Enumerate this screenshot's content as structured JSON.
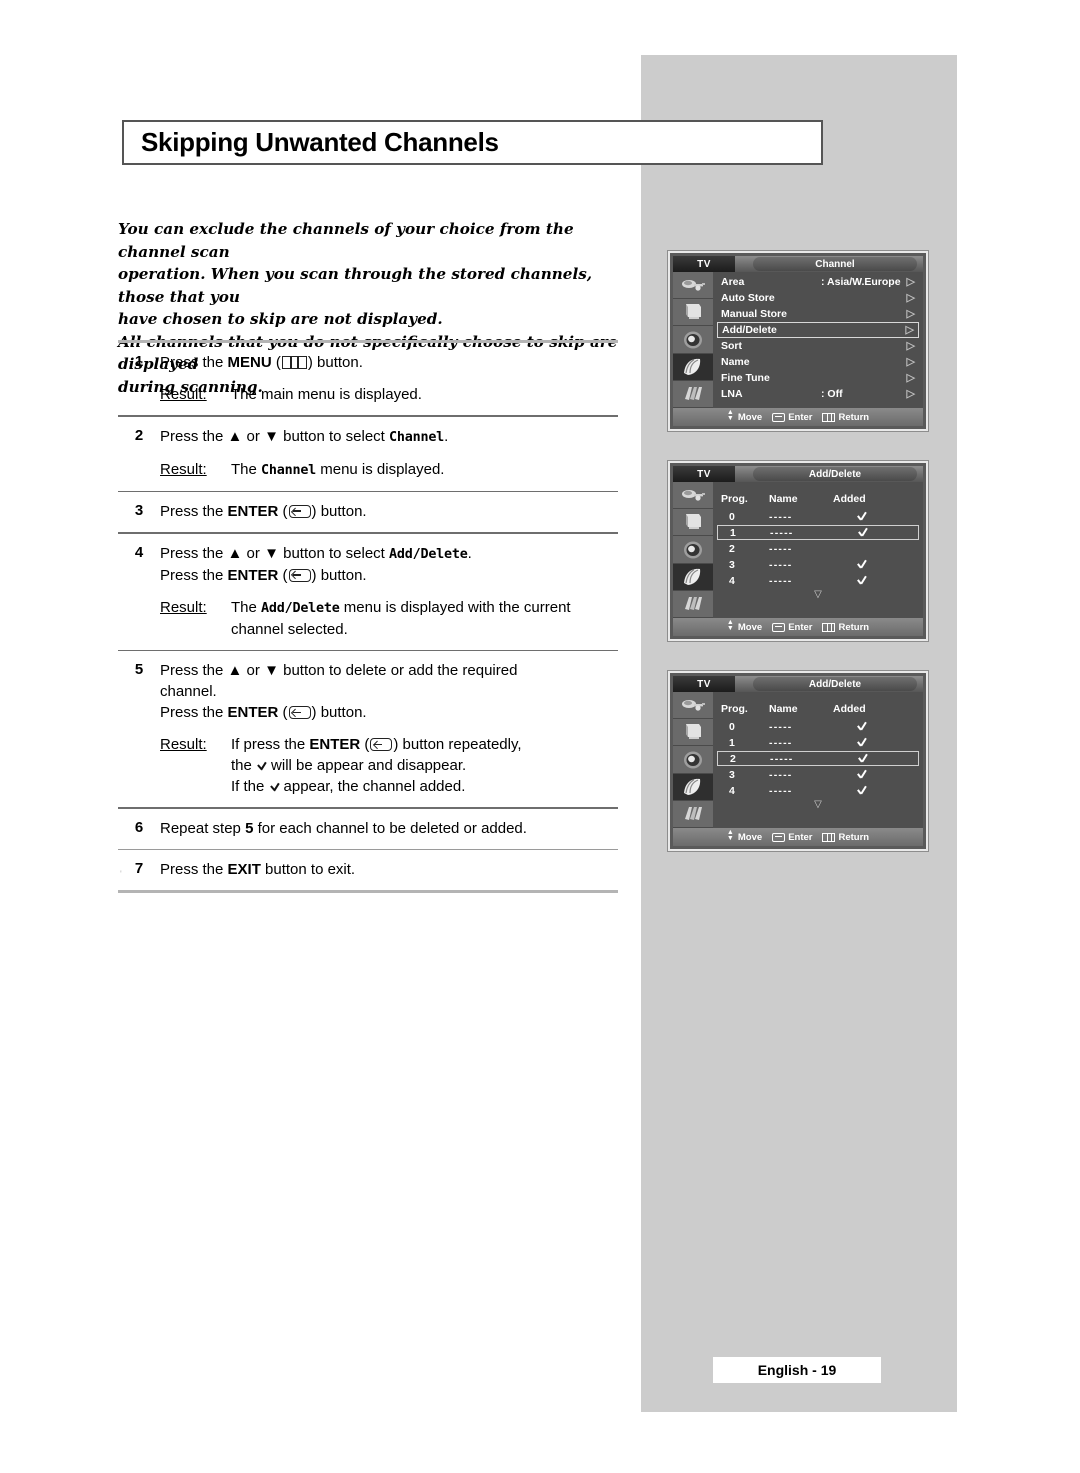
{
  "page": {
    "title": "Skipping Unwanted Channels",
    "footer_label": "English - 19"
  },
  "intro": {
    "line1": "You can exclude the channels of your choice from the channel scan",
    "line2": "operation. When you scan through the stored channels, those that you",
    "line3": "have chosen to skip are not displayed.",
    "line4": "All channels that you do not specifically choose to skip are displayed",
    "line5": "during scanning."
  },
  "steps": {
    "s1": {
      "num": "1",
      "t1a": "Press the ",
      "t1b": "MENU",
      "t1c": " (",
      "t1d": ") button.",
      "result_label": "Result:",
      "result_text": "The main menu is displayed."
    },
    "s2": {
      "num": "2",
      "t1a": "Press the ",
      "t1b": " or ",
      "t1c": " button to select ",
      "t1d": "Channel",
      "t1e": ".",
      "result_label": "Result:",
      "r1": "The ",
      "r2": "Channel",
      "r3": " menu is displayed."
    },
    "s3": {
      "num": "3",
      "t1a": "Press the ",
      "t1b": "ENTER",
      "t1c": " (",
      "t1d": ") button."
    },
    "s4": {
      "num": "4",
      "l1a": "Press the ",
      "l1b": " or ",
      "l1c": " button to select ",
      "l1d": "Add/Delete",
      "l1e": ".",
      "l2a": "Press the ",
      "l2b": "ENTER",
      "l2c": " (",
      "l2d": ") button.",
      "result_label": "Result:",
      "r1": "The ",
      "r2": "Add/Delete",
      "r3": " menu is displayed with the current",
      "r4": "channel selected."
    },
    "s5": {
      "num": "5",
      "l1a": "Press the ",
      "l1b": " or ",
      "l1c": " button to delete or add the required",
      "l2": "channel.",
      "l3a": "Press the ",
      "l3b": "ENTER",
      "l3c": " (",
      "l3d": ") button.",
      "result_label": "Result:",
      "r1a": "If press the ",
      "r1b": "ENTER",
      "r1c": " (",
      "r1d": ") button repeatedly,",
      "r2a": "the ",
      "r2b": "will be appear and disappear.",
      "r3a": "If the ",
      "r3b": "appear, the channel added."
    },
    "s6": {
      "num": "6",
      "t1a": "Repeat step ",
      "t1b": "5",
      "t1c": " for each channel to be deleted or added."
    },
    "s7": {
      "num": "7",
      "t1a": "Press the ",
      "t1b": "EXIT",
      "t1c": " button to exit."
    }
  },
  "osd": {
    "tv_label": "TV",
    "footer": {
      "move": "Move",
      "enter": "Enter",
      "return": "Return"
    },
    "screen1": {
      "title": "Channel",
      "items": [
        {
          "label": "Area",
          "value": ": Asia/W.Europe",
          "arrow": "▷",
          "selected": false
        },
        {
          "label": "Auto Store",
          "value": "",
          "arrow": "▷",
          "selected": false
        },
        {
          "label": "Manual Store",
          "value": "",
          "arrow": "▷",
          "selected": false
        },
        {
          "label": "Add/Delete",
          "value": "",
          "arrow": "▷",
          "selected": true
        },
        {
          "label": "Sort",
          "value": "",
          "arrow": "▷",
          "selected": false
        },
        {
          "label": "Name",
          "value": "",
          "arrow": "▷",
          "selected": false
        },
        {
          "label": "Fine Tune",
          "value": "",
          "arrow": "▷",
          "selected": false
        },
        {
          "label": "LNA",
          "value": ": Off",
          "arrow": "▷",
          "selected": false
        }
      ]
    },
    "screen2": {
      "title": "Add/Delete",
      "columns": [
        "Prog.",
        "Name",
        "Added"
      ],
      "rows": [
        {
          "prog": "0",
          "name": "-----",
          "added": true,
          "selected": false
        },
        {
          "prog": "1",
          "name": "-----",
          "added": true,
          "selected": true
        },
        {
          "prog": "2",
          "name": "-----",
          "added": false,
          "selected": false
        },
        {
          "prog": "3",
          "name": "-----",
          "added": true,
          "selected": false
        },
        {
          "prog": "4",
          "name": "-----",
          "added": true,
          "selected": false
        }
      ],
      "more_indicator": "▽"
    },
    "screen3": {
      "title": "Add/Delete",
      "columns": [
        "Prog.",
        "Name",
        "Added"
      ],
      "rows": [
        {
          "prog": "0",
          "name": "-----",
          "added": true,
          "selected": false
        },
        {
          "prog": "1",
          "name": "-----",
          "added": true,
          "selected": false
        },
        {
          "prog": "2",
          "name": "-----",
          "added": true,
          "selected": true
        },
        {
          "prog": "3",
          "name": "-----",
          "added": true,
          "selected": false
        },
        {
          "prog": "4",
          "name": "-----",
          "added": true,
          "selected": false
        }
      ],
      "more_indicator": "▽"
    },
    "sidebar_icons": [
      "antenna-icon",
      "picture-icon",
      "speaker-icon",
      "channel-icon",
      "setup-icon"
    ]
  },
  "colors": {
    "panel_grey": "#cccccc",
    "osd_bg": "#4f4f4f",
    "rule_grey": "#b4b4b4"
  }
}
